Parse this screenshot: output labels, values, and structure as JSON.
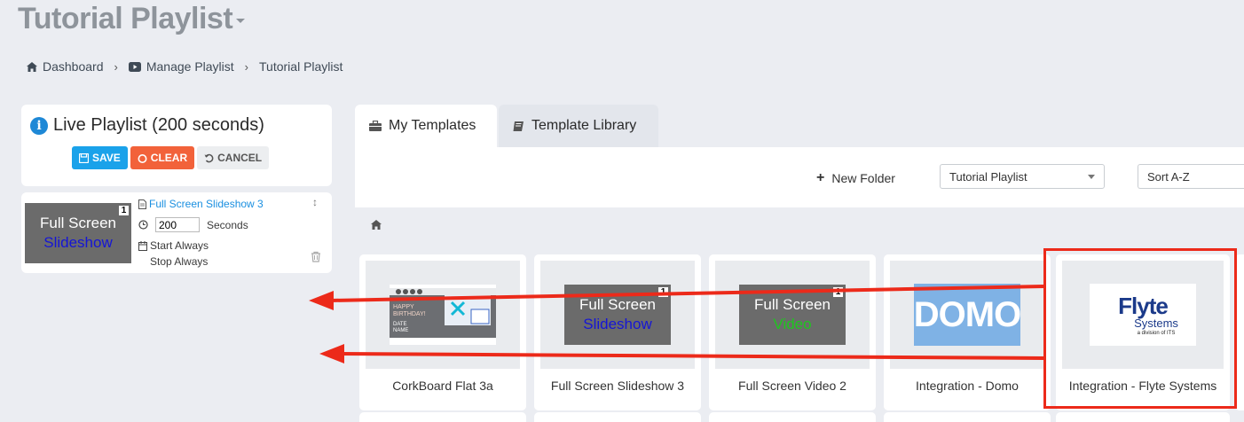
{
  "header": {
    "title": "Tutorial Playlist"
  },
  "breadcrumb": {
    "items": [
      "Dashboard",
      "Manage Playlist",
      "Tutorial Playlist"
    ]
  },
  "live_playlist": {
    "title": "Live Playlist (200 seconds)",
    "buttons": {
      "save": "SAVE",
      "clear": "CLEAR",
      "cancel": "CANCEL"
    },
    "items": [
      {
        "name": "Full Screen Slideshow 3",
        "thumb_line1": "Full Screen",
        "thumb_line2": "Slideshow",
        "badge": "1",
        "duration": "200",
        "duration_unit": "Seconds",
        "start": "Start Always",
        "stop": "Stop Always"
      }
    ]
  },
  "tabs": [
    {
      "label": "My Templates",
      "active": true
    },
    {
      "label": "Template Library",
      "active": false
    }
  ],
  "toolbar": {
    "new_folder": "New Folder",
    "folder_select": "Tutorial Playlist",
    "sort_select": "Sort A-Z"
  },
  "cards": [
    {
      "label": "CorkBoard Flat 3a",
      "cork_text": "HAPPY BIRTHDAY!",
      "cork_sub": "DATE NAME"
    },
    {
      "label": "Full Screen Slideshow 3",
      "line1": "Full Screen",
      "line2": "Slideshow",
      "badge": "1"
    },
    {
      "label": "Full Screen Video 2",
      "line1": "Full Screen",
      "line2": "Video",
      "badge": "1"
    },
    {
      "label": "Integration - Domo",
      "logo": "DOMO"
    },
    {
      "label": "Integration - Flyte Systems",
      "logo_l1": "Flyte",
      "logo_l2": "Systems",
      "logo_l3": "a division of ITS"
    }
  ],
  "colors": {
    "save": "#1aa2ea",
    "clear": "#f2623a",
    "link": "#1a8fe0",
    "annotation_red": "#ec2a1a",
    "slideshow_text": "#1515d6",
    "video_text": "#1ec71e"
  }
}
